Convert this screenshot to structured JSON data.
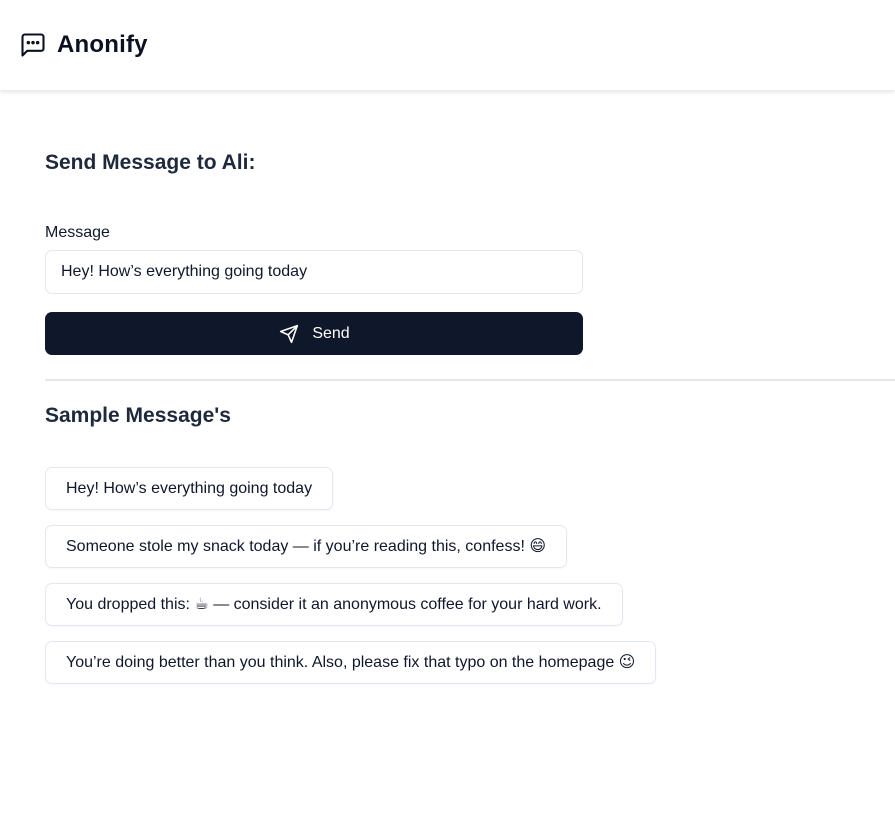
{
  "app": {
    "name": "Anonify",
    "logo_icon": "message-square-dots-icon"
  },
  "send_section": {
    "title": "Send Message to Ali:",
    "message_label": "Message",
    "message_value": "Hey! How’s everything going today",
    "send_label": "Send",
    "send_icon": "send-icon",
    "button_color": "#0f172a"
  },
  "samples": {
    "title": "Sample Message's",
    "items": [
      {
        "text": "Hey! How’s everything going today"
      },
      {
        "text": "Someone stole my snack today — if you’re reading this, confess! 😄"
      },
      {
        "text": "You dropped this: ☕ — consider it an anonymous coffee for your hard work."
      },
      {
        "text": "You’re doing better than you think. Also, please fix that typo on the homepage 😉"
      }
    ]
  }
}
